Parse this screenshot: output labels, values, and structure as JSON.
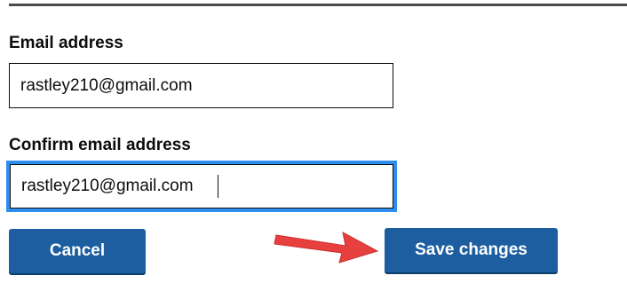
{
  "form": {
    "email_label": "Email address",
    "email_value": "rastley210@gmail.com",
    "confirm_label": "Confirm email address",
    "confirm_value": "rastley210@gmail.com"
  },
  "buttons": {
    "cancel_label": "Cancel",
    "save_label": "Save changes"
  },
  "colors": {
    "button_bg": "#1d5ea0",
    "focus_ring": "#2e8ef0",
    "arrow": "#e8403f"
  },
  "annotation": {
    "arrow_icon": "red-arrow-icon"
  }
}
